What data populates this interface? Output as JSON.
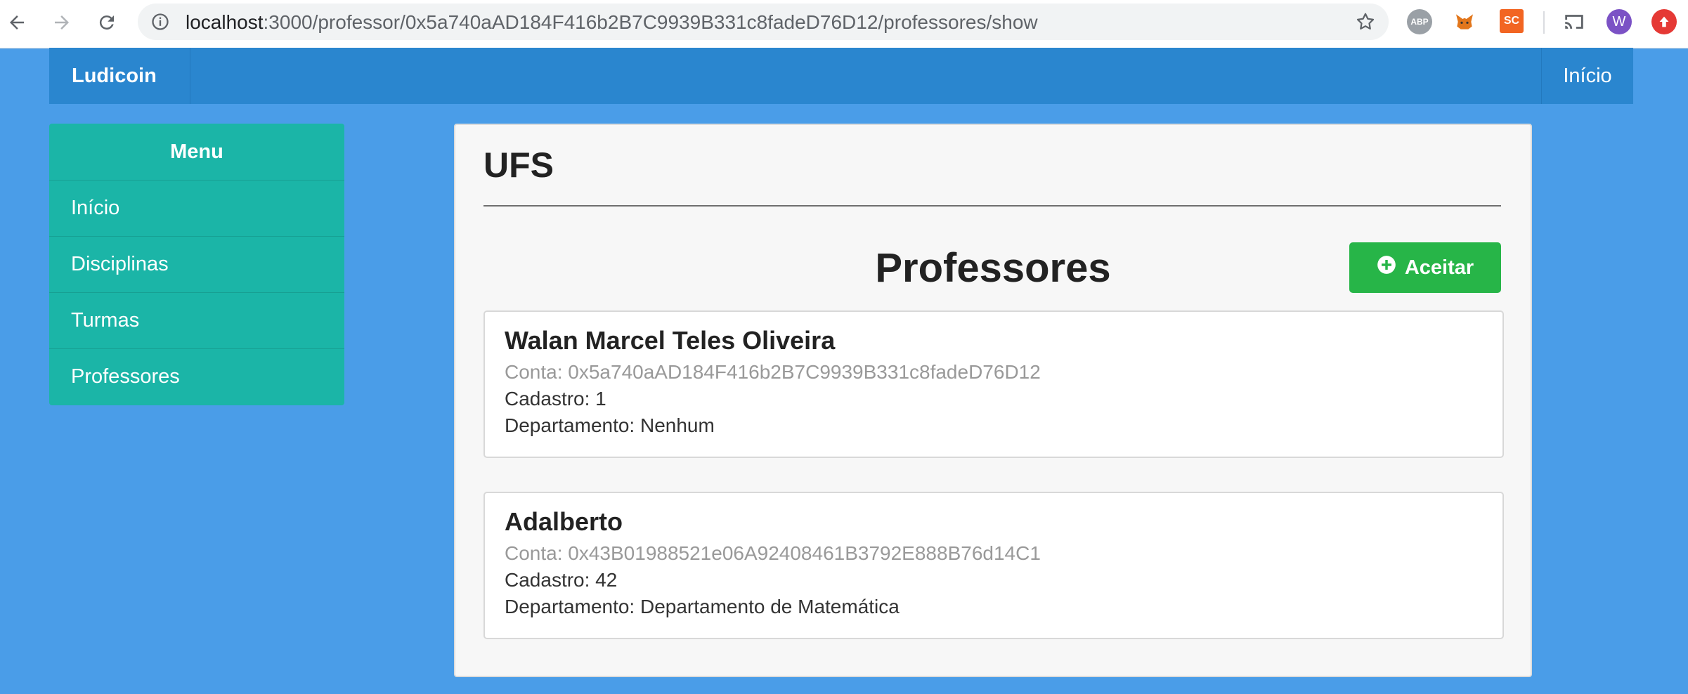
{
  "browser": {
    "url_host": "localhost",
    "url_rest": ":3000/professor/0x5a740aAD184F416b2B7C9939B331c8fadeD76D12/professores/show",
    "extensions": {
      "abp": "ABP",
      "sc": "SC",
      "avatar": "W"
    }
  },
  "navbar": {
    "brand": "Ludicoin",
    "right_link": "Início"
  },
  "menu": {
    "title": "Menu",
    "items": [
      {
        "label": "Início"
      },
      {
        "label": "Disciplinas"
      },
      {
        "label": "Turmas"
      },
      {
        "label": "Professores"
      }
    ]
  },
  "main": {
    "title": "UFS",
    "section_title": "Professores",
    "accept_button": "Aceitar",
    "professors": [
      {
        "name": "Walan Marcel Teles Oliveira",
        "account": "Conta: 0x5a740aAD184F416b2B7C9939B331c8fadeD76D12",
        "registration": "Cadastro: 1",
        "department": "Departamento: Nenhum"
      },
      {
        "name": "Adalberto",
        "account": "Conta: 0x43B01988521e06A92408461B3792E888B76d14C1",
        "registration": "Cadastro: 42",
        "department": "Departamento: Departamento de Matemática"
      }
    ]
  },
  "colors": {
    "background": "#4a9de8",
    "navbar": "#2a86cf",
    "menu": "#1bb5a7",
    "accept": "#27b548"
  }
}
